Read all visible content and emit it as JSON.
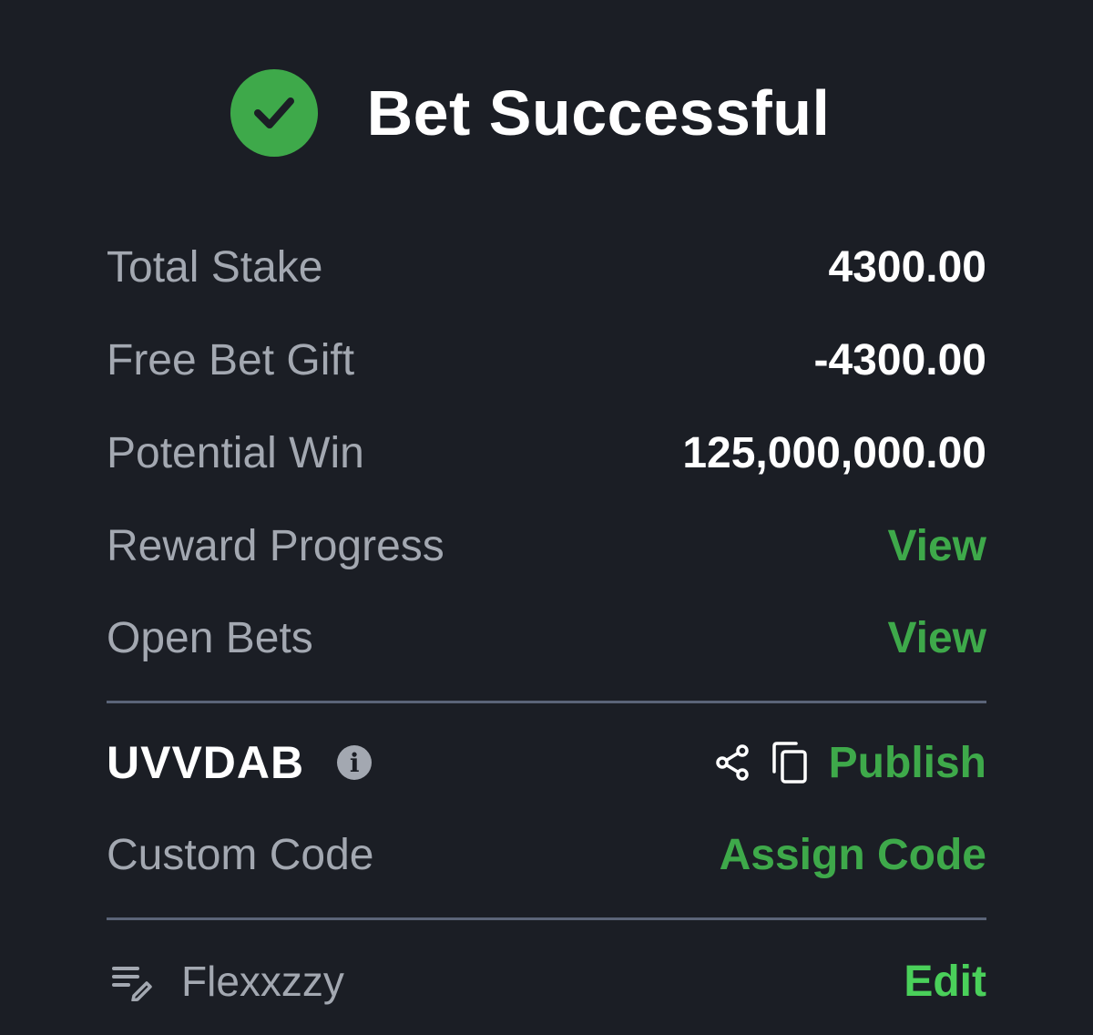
{
  "header": {
    "title": "Bet Successful"
  },
  "summary": {
    "total_stake_label": "Total Stake",
    "total_stake_value": "4300.00",
    "free_bet_label": "Free Bet Gift",
    "free_bet_value": "-4300.00",
    "potential_win_label": "Potential Win",
    "potential_win_value": "125,000,000.00",
    "reward_progress_label": "Reward Progress",
    "reward_progress_link": "View",
    "open_bets_label": "Open Bets",
    "open_bets_link": "View"
  },
  "booking": {
    "code": "UVVDAB",
    "info_glyph": "i",
    "publish_label": "Publish",
    "custom_code_label": "Custom Code",
    "assign_code_label": "Assign Code"
  },
  "footer": {
    "username": "Flexxzzy",
    "edit_label": "Edit"
  },
  "colors": {
    "background": "#1b1e25",
    "accent_green": "#3ea94a",
    "label_gray": "#a3a8b1",
    "divider": "#5b6478"
  },
  "icons": [
    "check-circle-icon",
    "info-icon",
    "share-icon",
    "copy-icon",
    "note-edit-icon"
  ]
}
